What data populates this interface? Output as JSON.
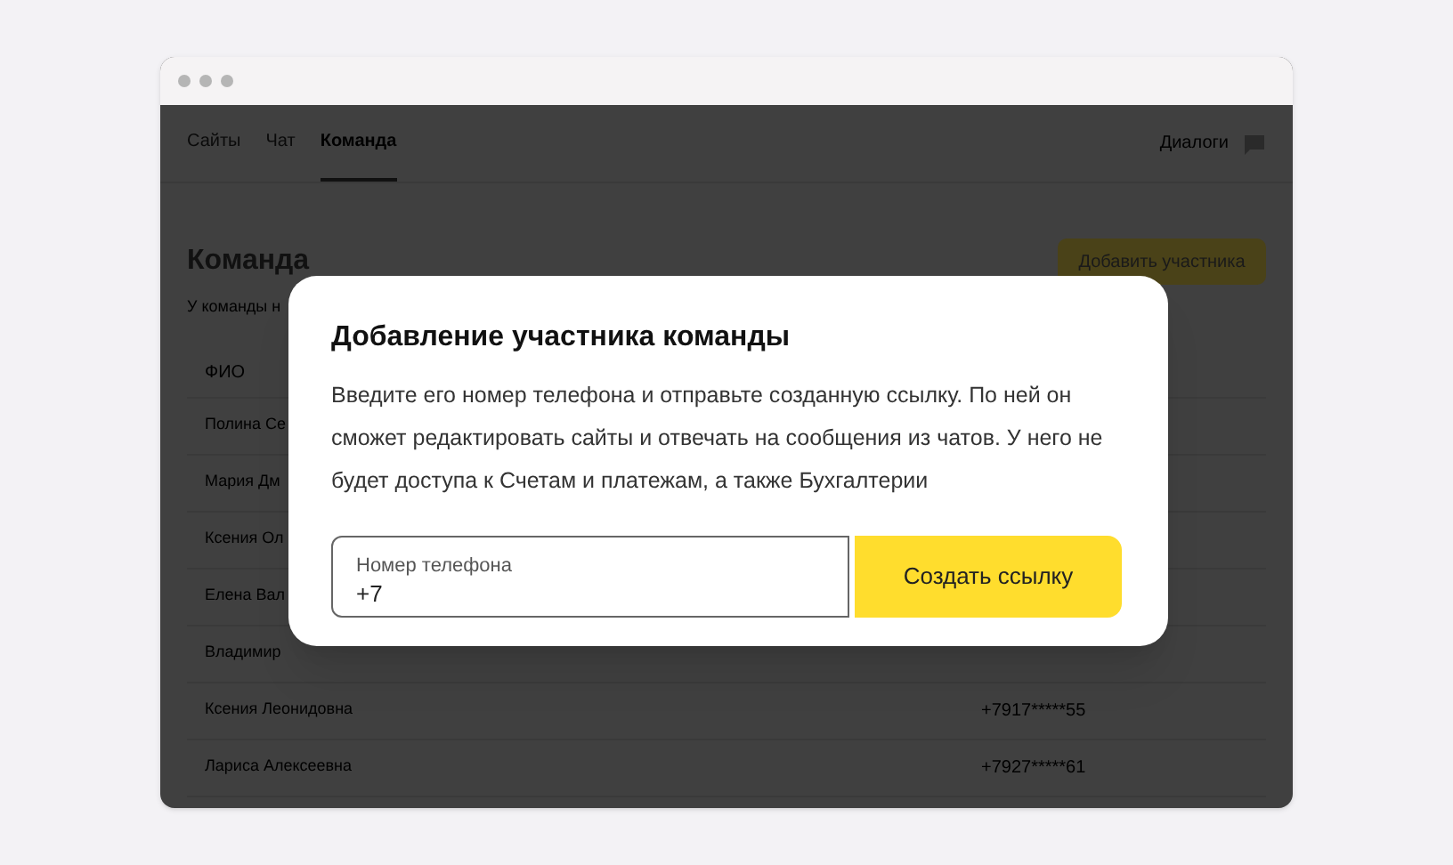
{
  "nav": {
    "tabs": [
      {
        "label": "Сайты",
        "selected": false
      },
      {
        "label": "Чат",
        "selected": false
      },
      {
        "label": "Команда",
        "selected": true
      }
    ],
    "dialogs": "Диалоги"
  },
  "page": {
    "title": "Команда",
    "add_button": "Добавить участника",
    "subtitle": "У команды н"
  },
  "table": {
    "columns": [
      "ФИО"
    ],
    "rows": [
      {
        "name": "Полина Се",
        "phone": ""
      },
      {
        "name": "Мария Дм",
        "phone": ""
      },
      {
        "name": "Ксения Ол",
        "phone": ""
      },
      {
        "name": "Елена Вал",
        "phone": ""
      },
      {
        "name": "Владимир",
        "phone": ""
      },
      {
        "name": "Ксения Леонидовна",
        "phone": "+7917*****55"
      },
      {
        "name": "Лариса Алексеевна",
        "phone": "+7927*****61"
      }
    ]
  },
  "modal": {
    "title": "Добавление участника команды",
    "text": "Введите его номер телефона и отправьте созданную ссылку. По ней он сможет редактировать сайты и отвечать на сообщения из чатов. У него не будет доступа к Счетам и платежам, а также Бухгалтерии",
    "field": {
      "label": "Номер телефона",
      "value": "+7"
    },
    "button": "Создать ссылку"
  }
}
